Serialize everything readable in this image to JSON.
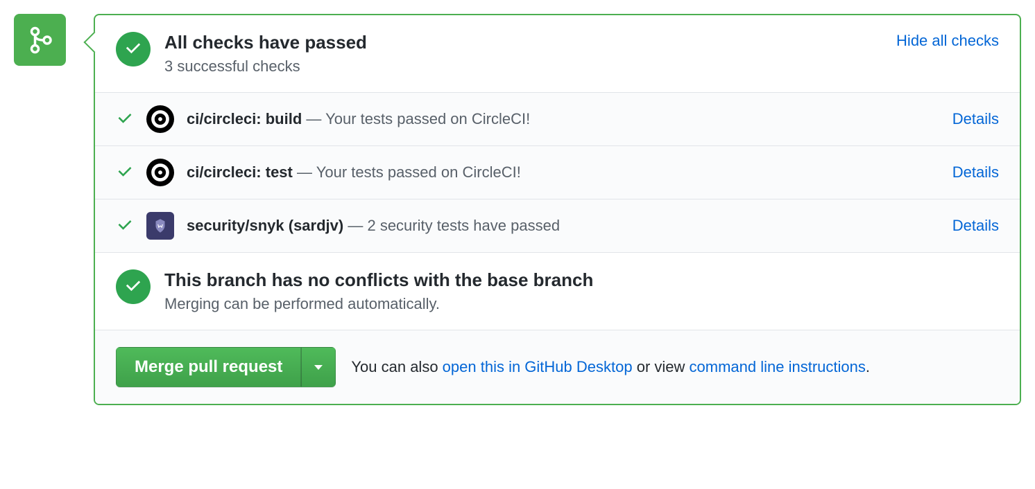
{
  "header": {
    "title": "All checks have passed",
    "subtitle": "3 successful checks",
    "toggle_label": "Hide all checks"
  },
  "checks": [
    {
      "icon": "circleci",
      "name": "ci/circleci: build",
      "sep": " — ",
      "desc": "Your tests passed on CircleCI!",
      "details_label": "Details"
    },
    {
      "icon": "circleci",
      "name": "ci/circleci: test",
      "sep": " — ",
      "desc": "Your tests passed on CircleCI!",
      "details_label": "Details"
    },
    {
      "icon": "snyk",
      "name": "security/snyk (sardjv)",
      "sep": " — ",
      "desc": "2 security tests have passed",
      "details_label": "Details"
    }
  ],
  "conflict": {
    "title": "This branch has no conflicts with the base branch",
    "subtitle": "Merging can be performed automatically."
  },
  "merge": {
    "button_label": "Merge pull request",
    "hint_prefix": "You can also ",
    "desktop_link": "open this in GitHub Desktop",
    "hint_mid": " or view ",
    "cli_link": "command line instructions",
    "hint_suffix": "."
  }
}
